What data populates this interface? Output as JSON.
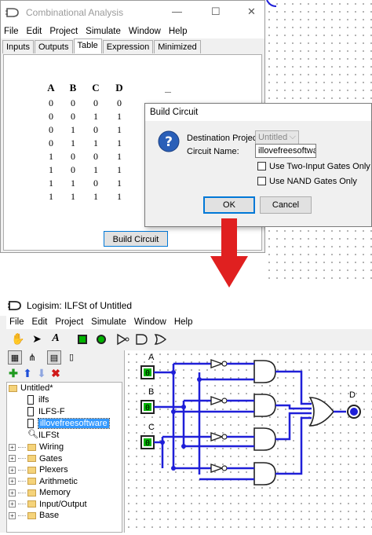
{
  "combinational_window": {
    "title": "Combinational Analysis",
    "controls": {
      "minimize": "—",
      "maximize": "☐",
      "close": "✕"
    },
    "menu": [
      "File",
      "Edit",
      "Project",
      "Simulate",
      "Window",
      "Help"
    ],
    "tabs": [
      "Inputs",
      "Outputs",
      "Table",
      "Expression",
      "Minimized"
    ],
    "active_tab": "Table",
    "truth_table": {
      "headers": [
        "A",
        "B",
        "C",
        "D"
      ],
      "rows": [
        [
          "0",
          "0",
          "0",
          "0"
        ],
        [
          "0",
          "0",
          "1",
          "1"
        ],
        [
          "0",
          "1",
          "0",
          "1"
        ],
        [
          "0",
          "1",
          "1",
          "1"
        ],
        [
          "1",
          "0",
          "0",
          "1"
        ],
        [
          "1",
          "0",
          "1",
          "1"
        ],
        [
          "1",
          "1",
          "0",
          "1"
        ],
        [
          "1",
          "1",
          "1",
          "1"
        ]
      ]
    },
    "build_button": "Build Circuit"
  },
  "build_dialog": {
    "title": "Build Circuit",
    "destination_label": "Destination Project:",
    "destination_value": "Untitled",
    "circuit_name_label": "Circuit Name:",
    "circuit_name_value": "illovefreesoftwar",
    "two_input_label": "Use Two-Input Gates Only",
    "nand_label": "Use NAND Gates Only",
    "ok_label": "OK",
    "cancel_label": "Cancel"
  },
  "logisim_window": {
    "title": "Logisim: ILFSt of Untitled",
    "menu": [
      "File",
      "Edit",
      "Project",
      "Simulate",
      "Window",
      "Help"
    ],
    "tree": {
      "root": "Untitled*",
      "circuits": [
        "ilfs",
        "ILFS-F",
        "illovefreesoftware",
        "ILFSt"
      ],
      "libraries": [
        "Wiring",
        "Gates",
        "Plexers",
        "Arithmetic",
        "Memory",
        "Input/Output",
        "Base"
      ]
    },
    "pins": {
      "inputs": [
        {
          "label": "A",
          "value": "0"
        },
        {
          "label": "B",
          "value": "0"
        },
        {
          "label": "C",
          "value": "0"
        }
      ],
      "output": {
        "label": "D"
      }
    },
    "colors": {
      "wire": "#1f1fd8",
      "pin_green": "#00b400",
      "selection": "#3399ff",
      "arrow": "#e02020"
    }
  }
}
